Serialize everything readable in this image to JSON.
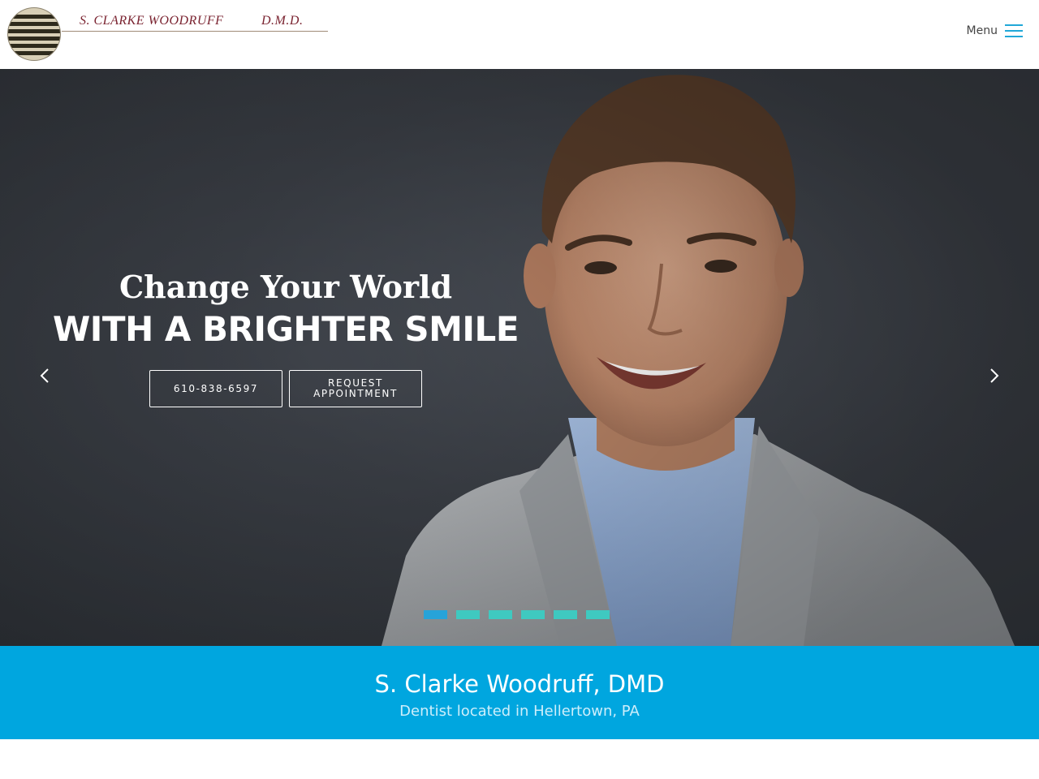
{
  "header": {
    "logo_name": "S. CLARKE WOODRUFF",
    "logo_suffix": "D.M.D.",
    "menu_label": "Menu"
  },
  "hero": {
    "title": "Change Your World",
    "subtitle": "WITH A BRIGHTER SMILE",
    "phone_button": "610-838-6597",
    "appointment_button": "REQUEST APPOINTMENT",
    "slide_count": 6,
    "active_slide": 1
  },
  "band": {
    "title": "S. Clarke Woodruff, DMD",
    "subtitle": "Dentist located in Hellertown, PA"
  },
  "colors": {
    "accent": "#00a6df",
    "dot_inactive": "#3fc9c0",
    "dot_active": "#27a3d9",
    "logo_text": "#7a2330"
  },
  "icons": {
    "menu": "hamburger-icon",
    "prev": "chevron-left-icon",
    "next": "chevron-right-icon"
  }
}
